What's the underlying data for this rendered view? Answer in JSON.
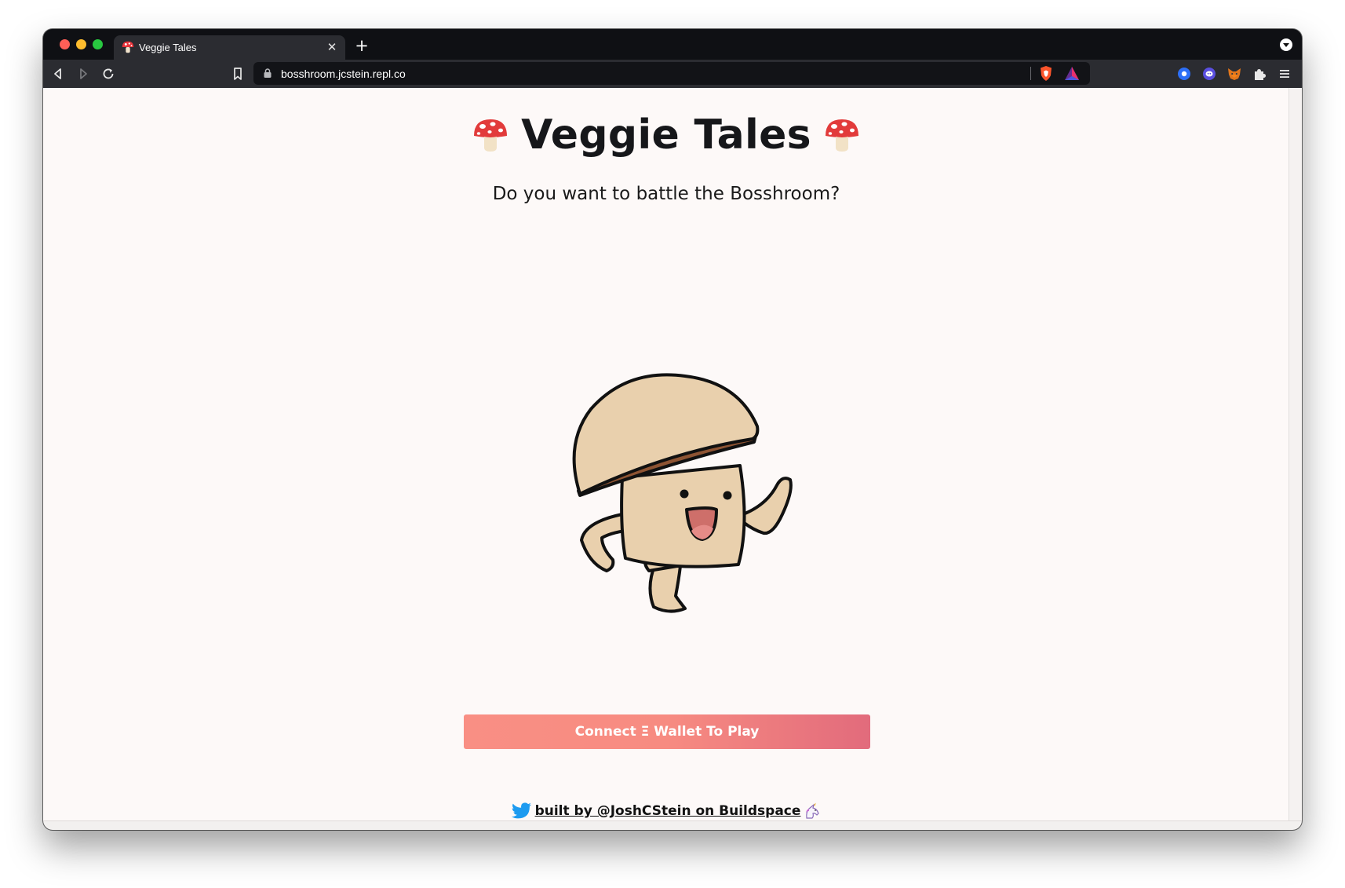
{
  "browser": {
    "tab": {
      "title": "Veggie Tales",
      "close_glyph": "✕",
      "favicon": "mushroom-icon"
    },
    "new_tab_glyph": "+",
    "url": "bosshroom.jcstein.repl.co"
  },
  "page": {
    "title": "Veggie Tales",
    "subtitle": "Do you want to battle the Bosshroom?",
    "connect_button": "Connect Ξ Wallet To Play",
    "footer_link": "built by @JoshCStein on Buildspace"
  },
  "colors": {
    "page_bg": "#fdf9f8",
    "button_start": "#f98f84",
    "button_end": "#e26b7c",
    "title": "#16171a"
  }
}
